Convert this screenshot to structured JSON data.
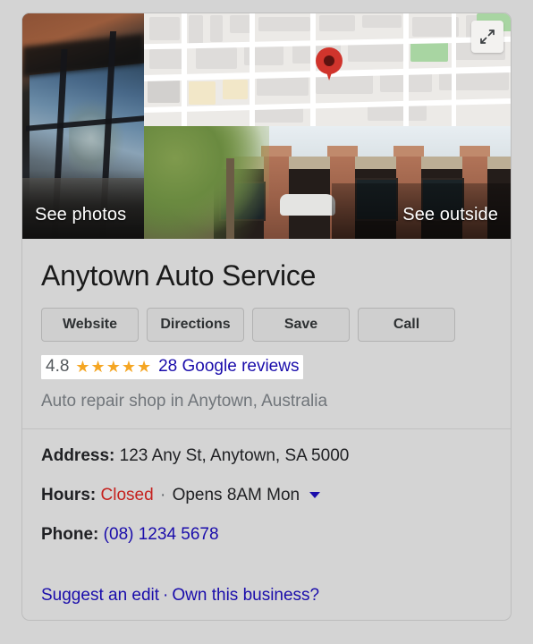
{
  "card": {
    "media": {
      "photo_tile": {
        "overlay_label": "See photos",
        "icon": "photo-thumbnail"
      },
      "map": {
        "pin_icon": "map-pin-icon",
        "expand_icon": "expand-arrows-icon"
      },
      "street_view": {
        "overlay_label": "See outside",
        "icon": "street-view-thumbnail"
      }
    },
    "title": "Anytown Auto Service",
    "actions": [
      {
        "label": "Website",
        "name": "website-button"
      },
      {
        "label": "Directions",
        "name": "directions-button"
      },
      {
        "label": "Save",
        "name": "save-button"
      },
      {
        "label": "Call",
        "name": "call-button"
      }
    ],
    "rating": {
      "score": "4.8",
      "stars_glyph": "★★★★★",
      "stars_filled": 5,
      "reviews_label": "28 Google reviews",
      "reviews_count": 28,
      "star_color": "#f5a623",
      "link_color": "#1a0dab"
    },
    "description": "Auto repair shop in Anytown, Australia",
    "facts": [
      {
        "name": "address",
        "label": "Address:",
        "value": "123 Any St, Anytown, SA 5000"
      },
      {
        "name": "hours",
        "label": "Hours:",
        "status": "Closed",
        "separator": "·",
        "next_open": "Opens 8AM Mon",
        "status_color": "#c5221f",
        "caret_icon": "chevron-down-icon"
      },
      {
        "name": "phone",
        "label": "Phone:",
        "value": "(08) 1234 5678",
        "value_color": "#1a0dab"
      }
    ],
    "footer": {
      "suggest_edit": "Suggest an edit",
      "separator": "·",
      "own_business": "Own this business?"
    }
  }
}
